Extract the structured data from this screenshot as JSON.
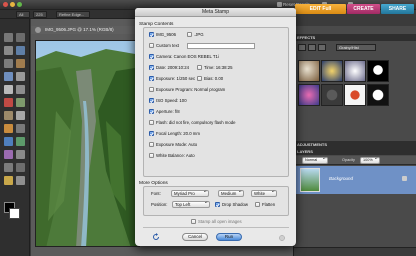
{
  "topbar": {
    "reset_panels": "Reset Panels",
    "undo": "Undo",
    "redo": "Redo"
  },
  "optbar": {
    "selection_option": "All",
    "size_value": "225",
    "refine_label": "Refine Edge..."
  },
  "modes": {
    "edit": "EDIT Full",
    "create": "CREATE",
    "share": "SHARE"
  },
  "document": {
    "tab_title": "IMG_9506.JPG @ 17.1% (RGB/8)"
  },
  "effects": {
    "header": "EFFECTS",
    "category_value": "Grainy/Hist"
  },
  "layers": {
    "adjustments_header": "ADJUSTMENTS",
    "header": "LAYERS",
    "blend_mode": "Normal",
    "opacity_label": "Opacity",
    "opacity_value": "100%",
    "layer_name": "Background"
  },
  "dialog": {
    "title": "Meta Stamp",
    "stamp_contents_label": "Stamp Contents",
    "filename": {
      "label": "IMG_9506",
      "checked": true
    },
    "jpg": {
      "label": ".JPG",
      "checked": false
    },
    "custom_text": {
      "label": "Custom text",
      "checked": false,
      "value": ""
    },
    "camera": {
      "label": "Camera: Canon EOS REBEL T1i",
      "checked": true
    },
    "date": {
      "label": "Date: 2009:10:24",
      "checked": true
    },
    "time": {
      "label": "Time: 16:38:25",
      "checked": false
    },
    "exposure": {
      "label": "Exposure: 1/250 sec",
      "checked": true
    },
    "bias": {
      "label": "Bias: 0.00",
      "checked": false
    },
    "exposure_program": {
      "label": "Exposure Program: Normal program",
      "checked": false
    },
    "iso": {
      "label": "ISO Speed: 100",
      "checked": true
    },
    "aperture": {
      "label": "Aperture: f/8",
      "checked": true
    },
    "flash": {
      "label": "Flash: did not fire, compulsory flash mode",
      "checked": false
    },
    "focal_length": {
      "label": "Focal Length: 20.0 mm",
      "checked": true
    },
    "exposure_mode": {
      "label": "Exposure Mode: Auto",
      "checked": false
    },
    "white_balance": {
      "label": "White Balance: Auto",
      "checked": false
    },
    "more_options_label": "More Options",
    "font_label": "Font:",
    "font_value": "Myriad Pro",
    "size_value": "Medium",
    "color_value": "White",
    "position_label": "Position:",
    "position_value": "Top Left",
    "drop_shadow": {
      "label": "Drop Shadow",
      "checked": true
    },
    "flatten": {
      "label": "Flatten",
      "checked": false
    },
    "stamp_all": {
      "label": "Stamp all open images",
      "checked": false
    },
    "cancel_label": "Cancel",
    "run_label": "Run"
  },
  "colors": {
    "edit_tab": "#e79d24",
    "create_tab": "#b9386f",
    "share_tab": "#2f8db5",
    "checkbox_on": "#3a78d8",
    "layer_selected": "#6f91c6"
  }
}
